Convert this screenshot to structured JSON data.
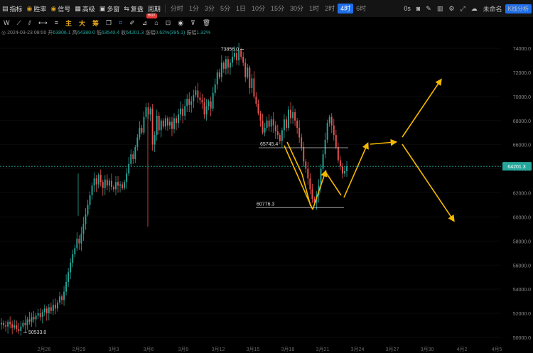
{
  "toolbar": {
    "items": [
      {
        "icon": "bars-icon",
        "label": "指标"
      },
      {
        "icon": "target-icon",
        "label": "胜率"
      },
      {
        "icon": "signal-icon",
        "label": "信号"
      },
      {
        "icon": "grid-icon",
        "label": "高级"
      },
      {
        "icon": "windows-icon",
        "label": "多窗"
      },
      {
        "icon": "replay-icon",
        "label": "复盘"
      },
      {
        "icon": "period-icon",
        "label": "周期"
      }
    ],
    "hot_badge": "HOT",
    "intervals": [
      "分时",
      "1分",
      "3分",
      "5分",
      "1日",
      "10分",
      "15分",
      "30分",
      "1时",
      "2时",
      "4时",
      "6时"
    ],
    "active_interval": "4时",
    "right": {
      "speed": "0s",
      "cloud": "未命名",
      "kline_button": "K线分析"
    }
  },
  "drawbar": {
    "labels": [
      "主",
      "大",
      "筹"
    ]
  },
  "ohlc": {
    "date": "2024-03-23 08:00",
    "open_label": "开",
    "open": "63806.1",
    "high_label": "高",
    "high": "64380.0",
    "low_label": "低",
    "low": "63540.4",
    "close_label": "收",
    "close": "64201.3",
    "change_label": "涨幅",
    "change": "0.62%(395.1)",
    "amp_label": "振幅",
    "amp": "1.32%"
  },
  "chart_data": {
    "type": "candlestick",
    "y_ticks": [
      "74000.0",
      "72000.0",
      "70000.0",
      "68000.0",
      "66000.0",
      "64000.0",
      "62000.0",
      "60000.0",
      "58000.0",
      "56000.0",
      "54000.0",
      "52000.0",
      "50000.0"
    ],
    "ylim": [
      49500,
      75200
    ],
    "x_ticks": [
      "2月26",
      "2月29",
      "3月3",
      "3月6",
      "3月9",
      "3月12",
      "3月15",
      "3月18",
      "3月21",
      "3月24",
      "3月27",
      "3月30",
      "4月2",
      "4月5"
    ],
    "last_price": "64201.3",
    "annotations": {
      "high": "73856.0",
      "low": "50533.0",
      "resistance": "65745.4",
      "support": "60776.3"
    },
    "colors": {
      "up": "#26a69a",
      "down": "#ef5350",
      "arrows": "#f5b800",
      "price_tag": "#26a69a"
    },
    "closes": [
      51200,
      51000,
      50900,
      51300,
      51100,
      50800,
      51000,
      50700,
      50533,
      50900,
      51200,
      51000,
      51500,
      51300,
      51700,
      51500,
      51800,
      52000,
      51700,
      52100,
      52400,
      52000,
      52500,
      52200,
      52700,
      52400,
      52900,
      53400,
      53100,
      53800,
      54600,
      55400,
      56200,
      56900,
      57400,
      58200,
      57800,
      58600,
      59400,
      60200,
      61000,
      61800,
      62600,
      63200,
      62700,
      63500,
      62900,
      62400,
      63100,
      62600,
      63000,
      62500,
      62300,
      62900,
      62600,
      62700,
      62400,
      62900,
      63600,
      64400,
      65200,
      64800,
      65800,
      66600,
      67400,
      67000,
      68300,
      69100,
      68500,
      69000,
      66000,
      66800,
      68400,
      67200,
      68000,
      67500,
      68200,
      67600,
      67900,
      67300,
      68200,
      67800,
      68500,
      69000,
      68400,
      69200,
      69800,
      69300,
      69600,
      70100,
      70500,
      69900,
      69700,
      69500,
      68500,
      69200,
      69600,
      69000,
      70300,
      71000,
      72000,
      71600,
      72800,
      72300,
      73100,
      72400,
      72800,
      73300,
      73600,
      73000,
      73856,
      73300,
      72800,
      71600,
      72400,
      70700,
      71500,
      70000,
      69400,
      68600,
      68000,
      67000,
      67400,
      68000,
      67500,
      68100,
      67600,
      67100,
      66800,
      66300,
      67200,
      68100,
      67400,
      68900,
      68200,
      68700,
      68000,
      67400,
      66600,
      65800,
      64600,
      64000,
      63200,
      62300,
      61500,
      61200,
      61800,
      62600,
      64000,
      65200,
      66400,
      67800,
      68300,
      67600,
      66800,
      65800,
      64700,
      64200,
      63600,
      63800,
      64201.3
    ]
  }
}
